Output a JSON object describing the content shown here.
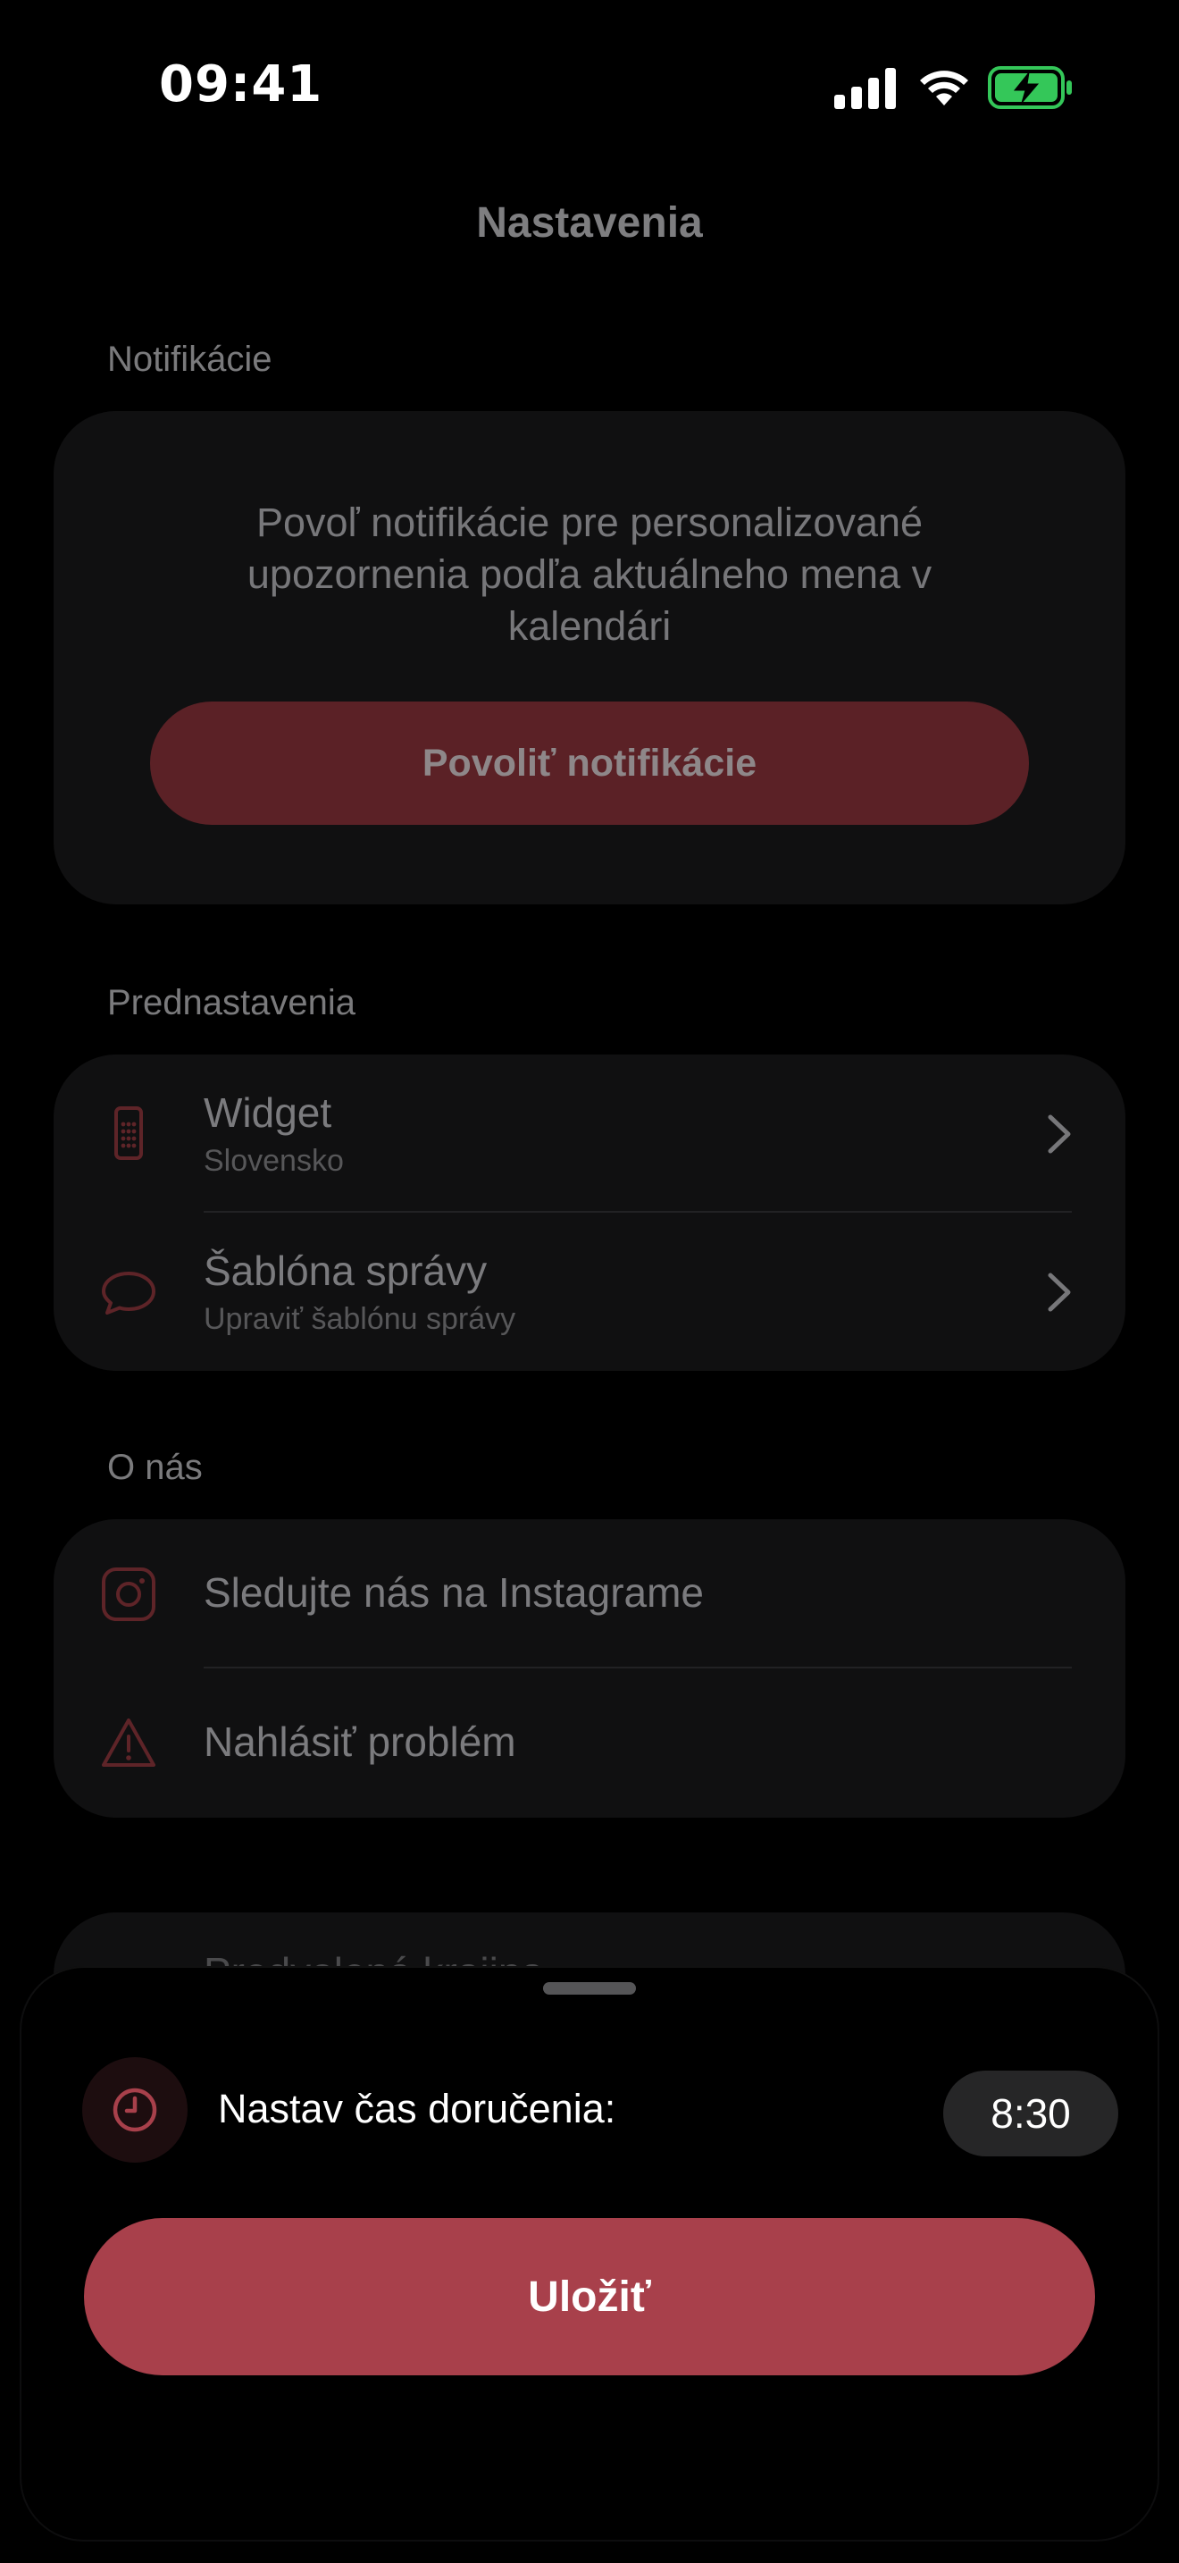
{
  "status_bar": {
    "time": "09:41"
  },
  "header": {
    "title": "Nastavenia"
  },
  "sections": {
    "notifications": {
      "label": "Notifikácie",
      "description": "Povoľ notifikácie pre personalizované upozornenia podľa aktuálneho mena v kalendári",
      "button_label": "Povoliť notifikácie"
    },
    "presets": {
      "label": "Prednastavenia",
      "items": [
        {
          "icon": "phone-icon",
          "title": "Widget",
          "subtitle": "Slovensko"
        },
        {
          "icon": "speech-bubble-icon",
          "title": "Šablóna správy",
          "subtitle": "Upraviť šablónu správy"
        }
      ]
    },
    "about": {
      "label": "O nás",
      "items": [
        {
          "icon": "instagram-icon",
          "title": "Sledujte nás na Instagrame"
        },
        {
          "icon": "warning-icon",
          "title": "Nahlásiť problém"
        }
      ]
    },
    "partial": {
      "title": "Predvolená krajina"
    }
  },
  "sheet": {
    "label": "Nastav čas doručenia:",
    "time_value": "8:30",
    "save_label": "Uložiť",
    "icon": "clock-icon"
  },
  "colors": {
    "accent": "#a8404b",
    "accent_dim": "#5b2126",
    "background": "#000000",
    "card": "#101011"
  }
}
